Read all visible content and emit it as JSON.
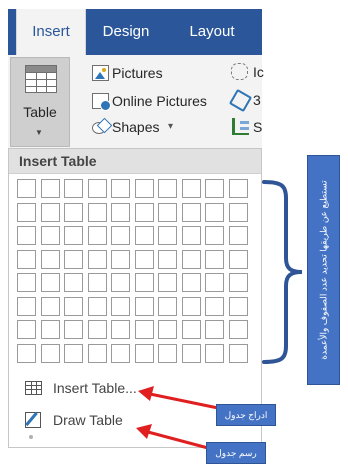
{
  "ribbon": {
    "tabs": [
      {
        "label": "Insert",
        "active": true
      },
      {
        "label": "Design",
        "active": false
      },
      {
        "label": "Layout",
        "active": false
      }
    ],
    "table_button": {
      "label": "Table"
    },
    "commands": {
      "pictures": "Pictures",
      "online_pictures": "Online Pictures",
      "shapes": "Shapes",
      "shapes_caret": "▾",
      "icons_partial": "Ic",
      "models_partial": "3",
      "smartart_partial": "S"
    },
    "accent_color": "#2b579a"
  },
  "insert_table_menu": {
    "header": "Insert Table",
    "grid": {
      "columns": 10,
      "rows": 8
    },
    "items": [
      {
        "label": "Insert Table...",
        "icon": "insert-table-icon"
      },
      {
        "label": "Draw Table",
        "icon": "draw-table-icon"
      }
    ]
  },
  "annotations": {
    "grid_note": "تستطيع عن طريقها تحديد عدد الصفوف والأعمدة",
    "insert_note": "ادراج جدول",
    "draw_note": "رسم جدول",
    "note_color": "#4472c4",
    "arrow_color": "#e02020"
  }
}
